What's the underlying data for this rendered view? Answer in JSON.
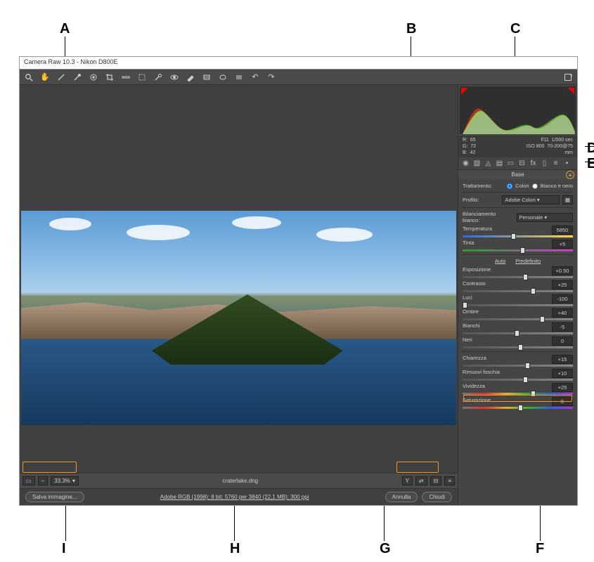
{
  "annotations": {
    "A": "A",
    "B": "B",
    "C": "C",
    "D": "D",
    "E": "E",
    "F": "F",
    "G": "G",
    "H": "H",
    "I": "I"
  },
  "window": {
    "title": "Camera Raw 10.3  -  Nikon D800E"
  },
  "toolbar": {
    "tools": [
      "zoom",
      "hand",
      "whitebalance",
      "color-sampler",
      "target-adjust",
      "crop",
      "straighten",
      "transform",
      "spot-removal",
      "redeye",
      "adjustment-brush",
      "graduated-filter",
      "radial-filter",
      "snapshot",
      "preferences",
      "rotate-ccw",
      "rotate-cw"
    ],
    "fullscreen_icon": "fullscreen"
  },
  "filmstrip": {
    "zoom": "33.3%",
    "filename": "craterlake.dng"
  },
  "footer": {
    "save_label": "Salva immagine...",
    "workflow_link": "Adobe RGB (1998); 8 bit; 5760 per 3840 (22,1 MB); 300 ppi",
    "cancel_label": "Annulla",
    "done_label": "Chiudi"
  },
  "readout": {
    "r_label": "R:",
    "r": "65",
    "g_label": "G:",
    "g": "72",
    "b_label": "B:",
    "b": "42",
    "aperture": "f/11",
    "shutter": "1/500 sec",
    "iso_label": "ISO 800",
    "lens": "70-200@75 mm"
  },
  "tabs": [
    "basic",
    "curve",
    "detail",
    "hsl",
    "split",
    "lens",
    "fx",
    "calib",
    "presets",
    "snapshots"
  ],
  "panel": {
    "title": "Base",
    "treatment_label": "Trattamento:",
    "treatment_color": "Colori",
    "treatment_bw": "Bianco e nero",
    "profile_label": "Profilo:",
    "profile_value": "Adobe Colori",
    "wb_label": "Bilanciamento bianco:",
    "wb_value": "Personale",
    "auto": "Auto",
    "default": "Predefinito",
    "sliders": {
      "temperature": {
        "label": "Temperatura",
        "value": "5850",
        "pos": 44
      },
      "tint": {
        "label": "Tinta",
        "value": "+5",
        "pos": 52
      },
      "exposure": {
        "label": "Esposizione",
        "value": "+0.50",
        "pos": 55
      },
      "contrast": {
        "label": "Contrasto",
        "value": "+25",
        "pos": 62
      },
      "highlights": {
        "label": "Luci",
        "value": "-100",
        "pos": 0
      },
      "shadows": {
        "label": "Ombre",
        "value": "+40",
        "pos": 70
      },
      "whites": {
        "label": "Bianchi",
        "value": "-5",
        "pos": 47
      },
      "blacks": {
        "label": "Neri",
        "value": "0",
        "pos": 50
      },
      "clarity": {
        "label": "Chiarezza",
        "value": "+15",
        "pos": 57
      },
      "dehaze": {
        "label": "Rimuovi foschia",
        "value": "+10",
        "pos": 55
      },
      "vibrance": {
        "label": "Vividezza",
        "value": "+25",
        "pos": 62
      },
      "saturation": {
        "label": "Saturazione",
        "value": "0",
        "pos": 50
      }
    }
  }
}
